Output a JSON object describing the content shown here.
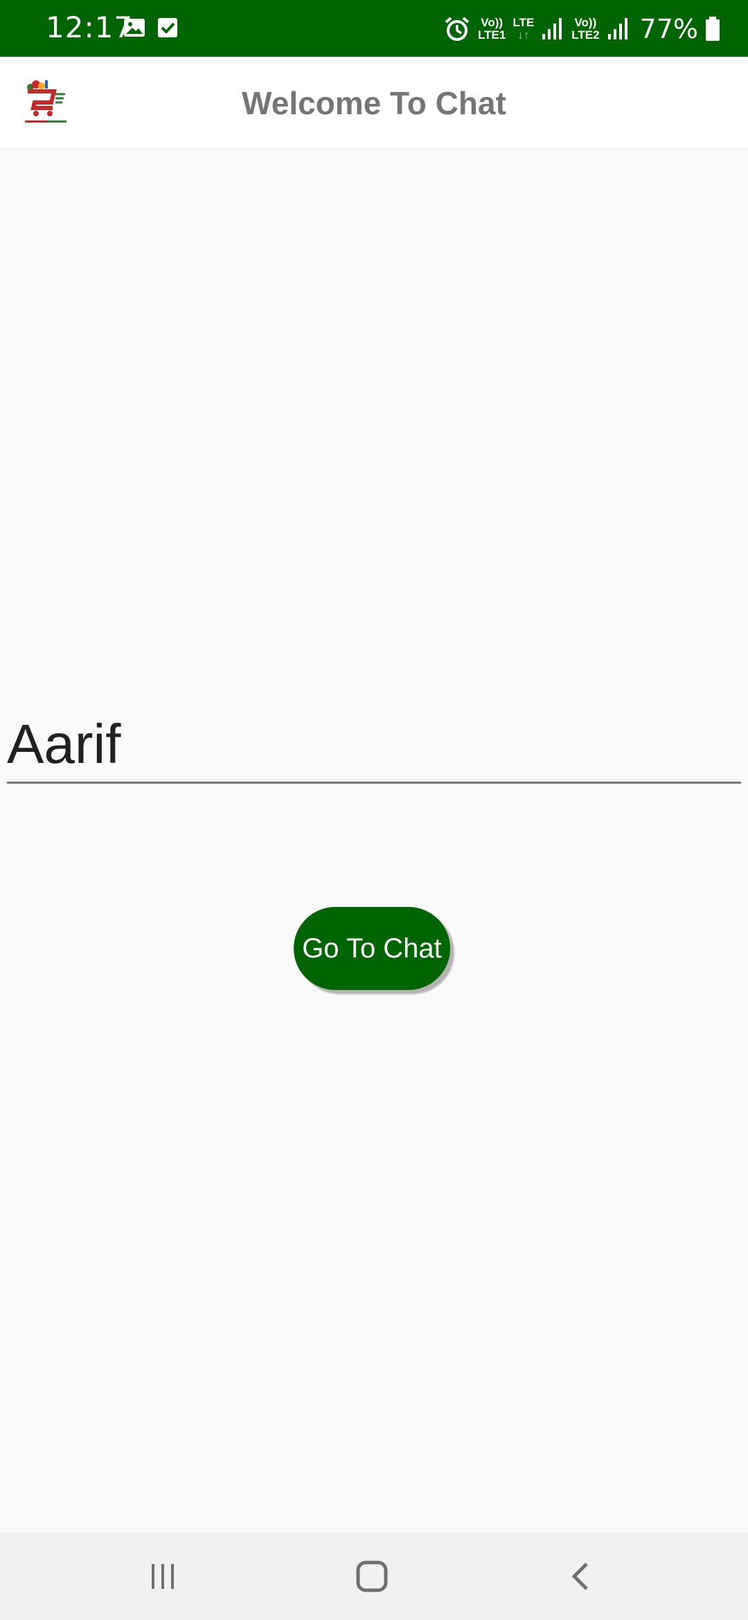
{
  "status_bar": {
    "time": "12:17",
    "background": "#006400",
    "left_icons": [
      "image-icon",
      "checkbox-icon"
    ],
    "right_icons": [
      "alarm-icon",
      "signal-icon",
      "signal-icon",
      "battery-icon"
    ],
    "volte1_top": "Vo))",
    "volte1_bottom": "LTE1",
    "lte_top": "LTE",
    "lte_bottom": "↓↑",
    "volte2_top": "Vo))",
    "volte2_bottom": "LTE2",
    "battery": "77%"
  },
  "app_bar": {
    "title": "Welcome To Chat",
    "logo": "app-logo"
  },
  "main": {
    "name_value": "Aarif",
    "button_label": "Go To Chat",
    "accent": "#006400"
  },
  "nav_bar": {
    "items": [
      "recent-apps-icon",
      "home-icon",
      "back-icon"
    ]
  }
}
